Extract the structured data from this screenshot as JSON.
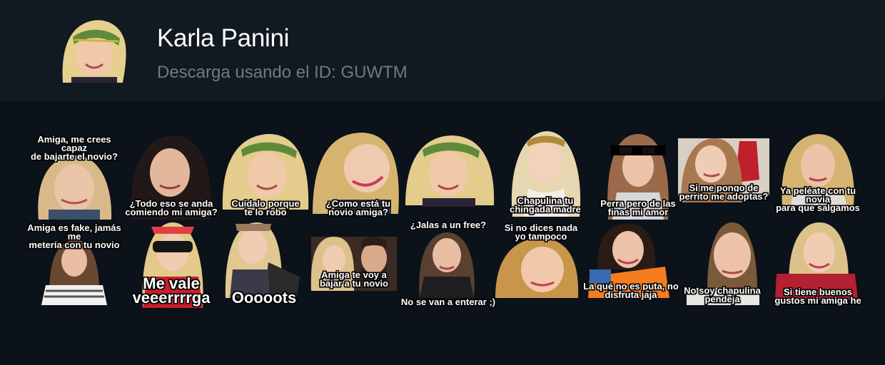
{
  "pack": {
    "title": "Karla Panini",
    "subtitle": "Descarga usando el ID: GUWTM",
    "thumbnail_icon": "pack-avatar-icon"
  },
  "stickers": [
    {
      "caption_top": "Amiga, me crees capaz\nde bajarte el novio?",
      "caption_bottom": ""
    },
    {
      "caption_top": "",
      "caption_bottom": "¿Todo eso se anda\ncomiendo mi amiga?"
    },
    {
      "caption_top": "",
      "caption_bottom": "Cuídalo porque\nte lo robo"
    },
    {
      "caption_top": "",
      "caption_bottom": "¿Como está tu\nnovio amiga?"
    },
    {
      "caption_top": "",
      "caption_bottom": ""
    },
    {
      "caption_top": "",
      "caption_bottom": "Chapulina tu\nchingada madre"
    },
    {
      "caption_top": "",
      "caption_bottom": "Perra pero de las\nfinas mi amor"
    },
    {
      "caption_top": "",
      "caption_bottom": "Si me pongo de\nperrito me adoptas?"
    },
    {
      "caption_top": "",
      "caption_bottom": "Ya peléate con tu novia\npara que salgamos"
    },
    {
      "caption_top": "Amiga es fake, jamás me\nmetería con tu novio",
      "caption_bottom": ""
    },
    {
      "caption_top": "",
      "caption_bottom": "Me vale\nveeerrrrga"
    },
    {
      "caption_top": "",
      "caption_bottom": "Ooooots"
    },
    {
      "caption_top": "",
      "caption_bottom": "Amiga te voy a\nbajar a tu novio"
    },
    {
      "caption_top": "¿Jalas a un free?",
      "caption_bottom": "No se van a enterar ;)"
    },
    {
      "caption_top": "Si no dices nada\nyo tampoco",
      "caption_bottom": ""
    },
    {
      "caption_top": "",
      "caption_bottom": "La qué no es puta, no\ndisfruta jaja"
    },
    {
      "caption_top": "",
      "caption_bottom": "No soy chapulina\npendeja"
    },
    {
      "caption_top": "",
      "caption_bottom": "Si tiene buenos\ngustos mi amiga he"
    }
  ],
  "colors": {
    "header_bg": "#111a21",
    "page_bg": "#0b1219",
    "title": "#ffffff",
    "subtitle": "#6f7a82"
  }
}
